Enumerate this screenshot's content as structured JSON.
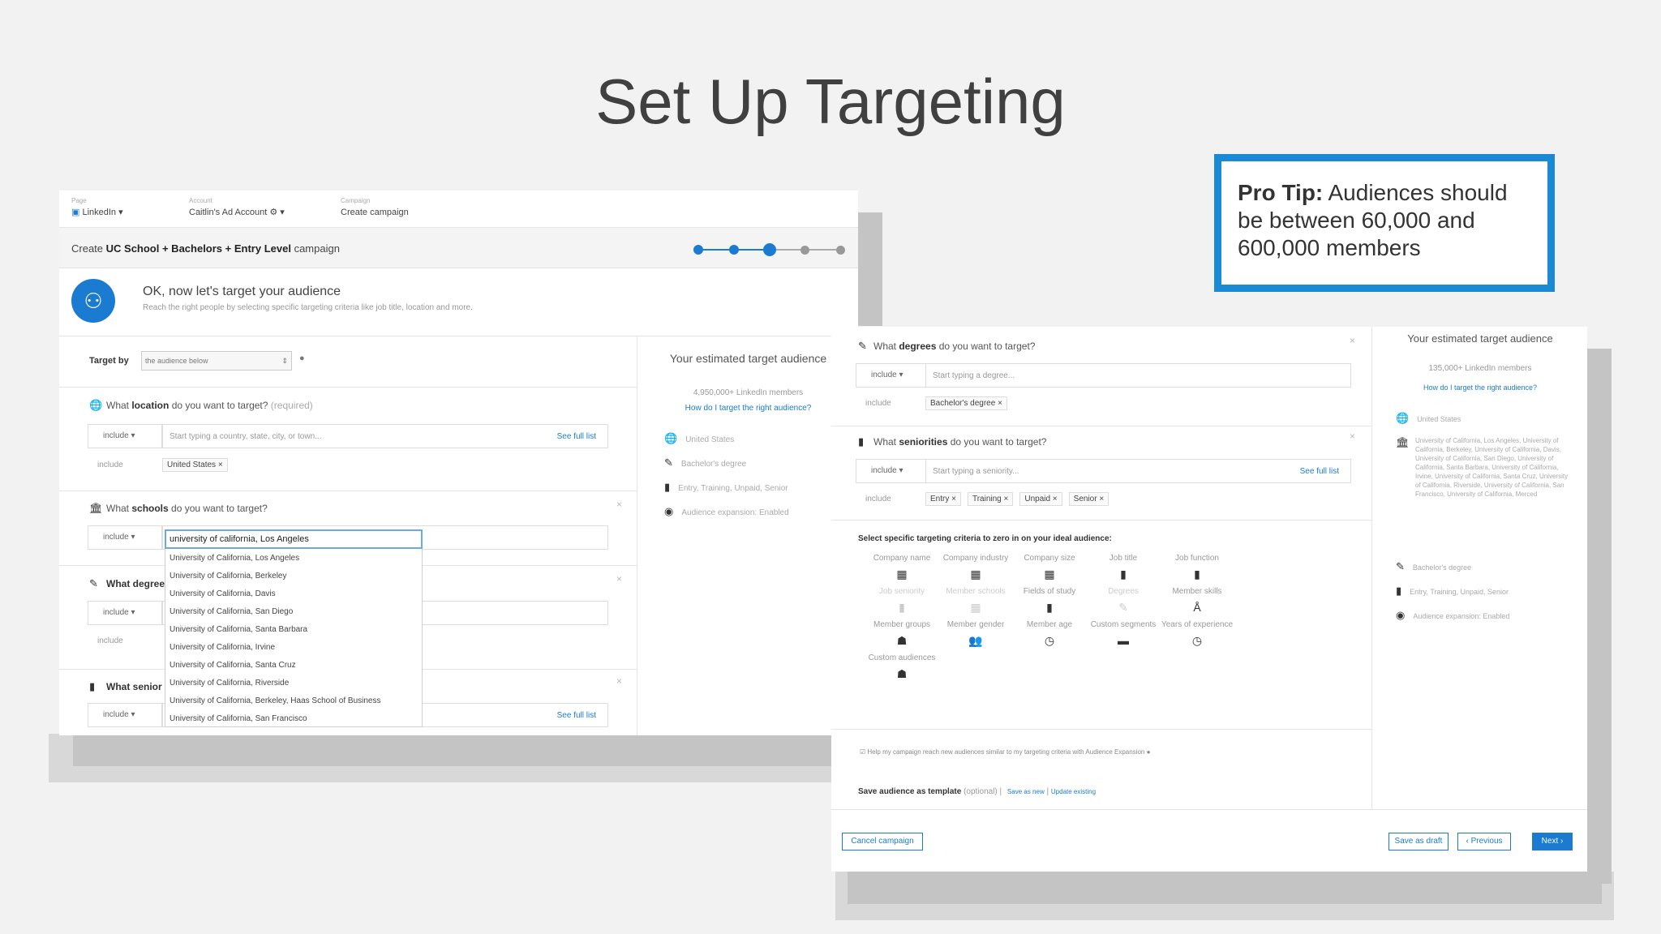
{
  "slide": {
    "title": "Set Up Targeting",
    "protip_label": "Pro Tip:",
    "protip_text": " Audiences should be between 60,000 and 600,000 members"
  },
  "shotA": {
    "topbar": {
      "page_label": "Page",
      "page_value": "LinkedIn ▾",
      "account_label": "Account",
      "account_value": "Caitlin's Ad Account ⚙ ▾",
      "campaign_label": "Campaign",
      "campaign_value": "Create campaign"
    },
    "campaign_prefix": "Create ",
    "campaign_name": "UC School + Bachelors + Entry Level",
    "campaign_suffix": " campaign",
    "hero_title": "OK, now let's target your audience",
    "hero_sub": "Reach the right people by selecting specific targeting criteria like job title, location and more.",
    "target_by_label": "Target by",
    "target_by_value": "the audience below",
    "location_q_pre": "What ",
    "location_q_bold": "location",
    "location_q_post": " do you want to target?",
    "location_required": " (required)",
    "include": "include ▾",
    "include_plain": "include",
    "location_placeholder": "Start typing a country, state, city, or town...",
    "see_full_list": "See full list",
    "location_chip": "United States ×",
    "schools_q_pre": "What ",
    "schools_q_bold": "schools",
    "schools_q_post": " do you want to target?",
    "schools_input": "university of california, Los Angeles",
    "school_options": [
      "University of California, Los Angeles",
      "University of California, Berkeley",
      "University of California, Davis",
      "University of California, San Diego",
      "University of California, Santa Barbara",
      "University of California, Irvine",
      "University of California, Santa Cruz",
      "University of California, Riverside",
      "University of California, Berkeley, Haas School of Business",
      "University of California, San Francisco"
    ],
    "degrees_q": "What degree",
    "seniority_q": "What senior",
    "est_title": "Your estimated target audience",
    "est_members": "4,950,000+ LinkedIn members",
    "est_link": "How do I target the right audience?",
    "criteria": [
      "United States",
      "Bachelor's degree",
      "Entry, Training, Unpaid, Senior",
      "Audience expansion: Enabled"
    ]
  },
  "shotB": {
    "degrees_q_pre": "What ",
    "degrees_q_bold": "degrees",
    "degrees_q_post": " do you want to target?",
    "include": "include ▾",
    "include_plain": "include",
    "degrees_placeholder": "Start typing a degree...",
    "degree_chip": "Bachelor's degree ×",
    "seniority_q_pre": "What ",
    "seniority_q_bold": "seniorities",
    "seniority_q_post": " do you want to target?",
    "seniority_placeholder": "Start typing a seniority...",
    "see_full_list": "See full list",
    "seniority_chips": [
      "Entry ×",
      "Training ×",
      "Unpaid ×",
      "Senior ×"
    ],
    "specific_title": "Select specific targeting criteria to zero in on your ideal audience:",
    "grid": [
      {
        "label": "Company name",
        "icon": "building-icon",
        "glyph": "▦",
        "faded": false
      },
      {
        "label": "Company industry",
        "icon": "building-icon",
        "glyph": "▦",
        "faded": false
      },
      {
        "label": "Company size",
        "icon": "building-icon",
        "glyph": "▦",
        "faded": false
      },
      {
        "label": "Job title",
        "icon": "document-icon",
        "glyph": "▮",
        "faded": false
      },
      {
        "label": "Job function",
        "icon": "document-icon",
        "glyph": "▮",
        "faded": false
      },
      {
        "label": "Job seniority",
        "icon": "document-icon",
        "glyph": "▮",
        "faded": true
      },
      {
        "label": "Member schools",
        "icon": "building-icon",
        "glyph": "▦",
        "faded": true
      },
      {
        "label": "Fields of study",
        "icon": "document-icon",
        "glyph": "▮",
        "faded": false
      },
      {
        "label": "Degrees",
        "icon": "pen-icon",
        "glyph": "✎",
        "faded": true
      },
      {
        "label": "Member skills",
        "icon": "person-icon",
        "glyph": "Å",
        "faded": false
      },
      {
        "label": "Member groups",
        "icon": "group-icon",
        "glyph": "☗",
        "faded": false
      },
      {
        "label": "Member gender",
        "icon": "people-icon",
        "glyph": "👥",
        "faded": false
      },
      {
        "label": "Member age",
        "icon": "clock-icon",
        "glyph": "◷",
        "faded": false
      },
      {
        "label": "Custom segments",
        "icon": "folder-icon",
        "glyph": "▬",
        "faded": false
      },
      {
        "label": "Years of experience",
        "icon": "clock-icon",
        "glyph": "◷",
        "faded": false
      },
      {
        "label": "Custom audiences",
        "icon": "group-icon",
        "glyph": "☗",
        "faded": false
      }
    ],
    "expansion_text": "Help my campaign reach new audiences similar to my targeting criteria with Audience Expansion",
    "save_template": "Save audience as template",
    "optional": " (optional) |",
    "save_as_new": "Save as new",
    "update_existing": "Update existing",
    "est_title": "Your estimated target audience",
    "est_members": "135,000+ LinkedIn members",
    "est_link": "How do I target the right audience?",
    "crit_country": "United States",
    "crit_schools": "University of California, Los Angeles, University of California, Berkeley, University of California, Davis, University of California, San Diego, University of California, Santa Barbara, University of California, Irvine, University of California, Santa Cruz, University of California, Riverside, University of California, San Francisco, University of California, Merced",
    "crit_degree": "Bachelor's degree",
    "crit_seniority": "Entry, Training, Unpaid, Senior",
    "crit_expansion": "Audience expansion: Enabled",
    "cancel": "Cancel campaign",
    "save_draft": "Save as draft",
    "previous": "‹ Previous",
    "next": "Next ›"
  }
}
